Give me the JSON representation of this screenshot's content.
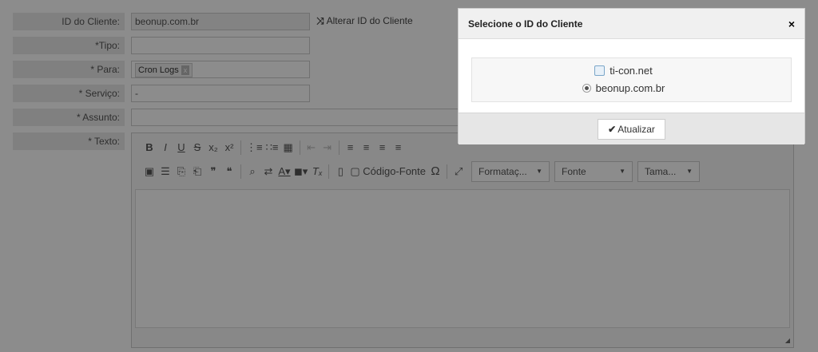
{
  "form": {
    "client_id_label": "ID do Cliente:",
    "client_id_value": "beonup.com.br",
    "alter_link": "Alterar ID do Cliente",
    "tipo_label": "*Tipo:",
    "para_label": "* Para:",
    "para_tag": "Cron Logs",
    "para_tag_remove": "x",
    "servico_label": "* Serviço:",
    "servico_value": "-",
    "assunto_label": "* Assunto:",
    "texto_label": "* Texto:"
  },
  "editor": {
    "row1": [
      "B",
      "I",
      "U",
      "S",
      "x₂",
      "x²",
      "⋮≡",
      "∷≡",
      "▦",
      "⇤",
      "⇥",
      "≡",
      "≡",
      "≡",
      "≡"
    ],
    "row2_tail_label": "Código-Fonte",
    "omega": "Ω",
    "dropdowns": [
      "Formataç...",
      "Fonte",
      "Tama..."
    ]
  },
  "modal": {
    "title": "Selecione o ID do Cliente",
    "close": "×",
    "options": [
      "ti-con.net",
      "beonup.com.br"
    ],
    "button_label": "Atualizar",
    "button_icon": "✔"
  }
}
